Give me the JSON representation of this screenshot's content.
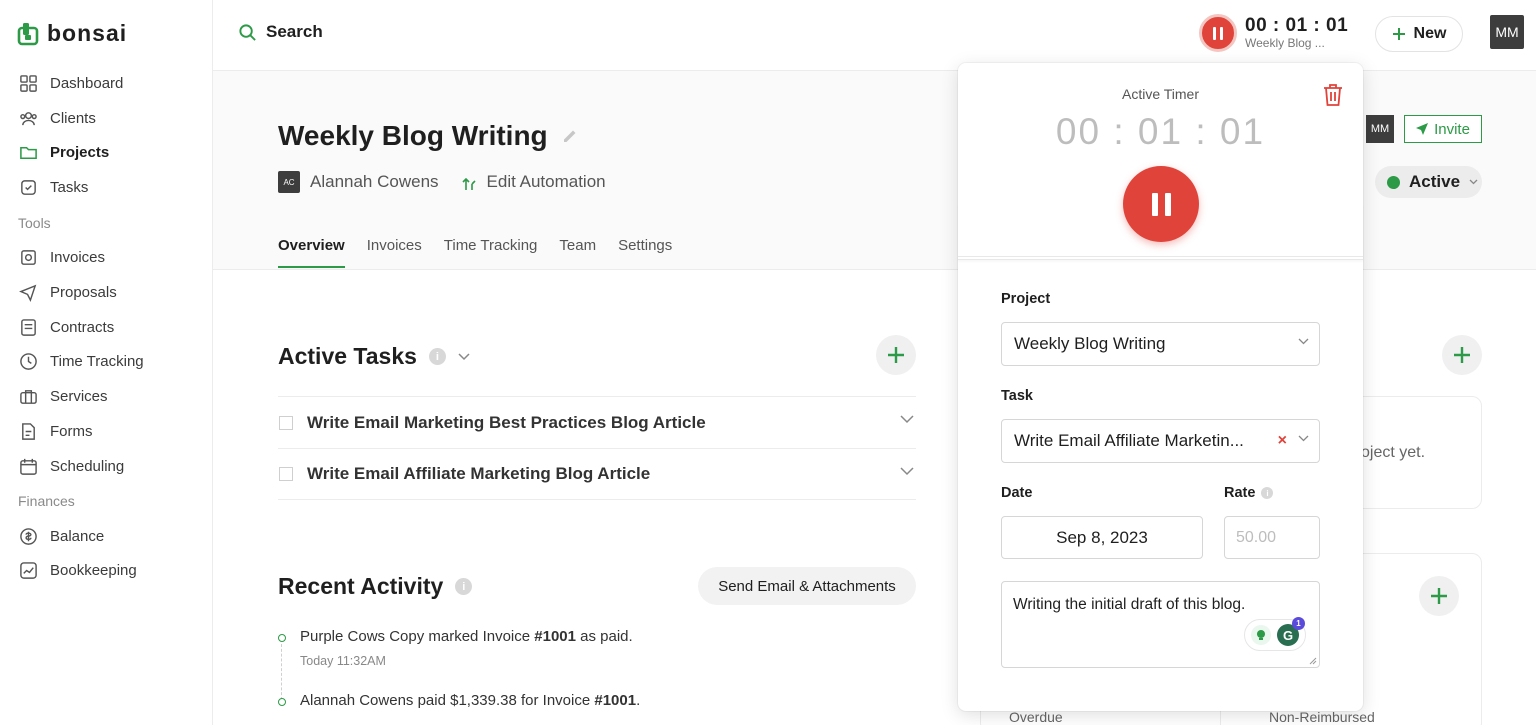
{
  "brand": {
    "name": "bonsai",
    "color": "#2c9a47"
  },
  "sidebar": {
    "items": [
      {
        "label": "Dashboard",
        "icon": "dashboard-icon"
      },
      {
        "label": "Clients",
        "icon": "clients-icon"
      },
      {
        "label": "Projects",
        "icon": "folder-icon",
        "active": true
      },
      {
        "label": "Tasks",
        "icon": "tasks-icon"
      }
    ],
    "tools_label": "Tools",
    "tools": [
      {
        "label": "Invoices",
        "icon": "invoice-icon"
      },
      {
        "label": "Proposals",
        "icon": "send-icon"
      },
      {
        "label": "Contracts",
        "icon": "contract-icon"
      },
      {
        "label": "Time Tracking",
        "icon": "clock-icon"
      },
      {
        "label": "Services",
        "icon": "briefcase-icon"
      },
      {
        "label": "Forms",
        "icon": "form-icon"
      },
      {
        "label": "Scheduling",
        "icon": "calendar-icon"
      }
    ],
    "finances_label": "Finances",
    "finances": [
      {
        "label": "Balance",
        "icon": "balance-icon"
      },
      {
        "label": "Bookkeeping",
        "icon": "chart-icon"
      }
    ]
  },
  "topbar": {
    "search_label": "Search",
    "timer": {
      "time": "00 : 01 : 01",
      "subtitle": "Weekly Blog ..."
    },
    "new_label": "New",
    "avatar": "MM"
  },
  "project": {
    "title": "Weekly Blog Writing",
    "client_initials": "AC",
    "client_name": "Alannah Cowens",
    "automation_label": "Edit Automation",
    "team_avatar": "MM",
    "invite_label": "Invite",
    "status": "Active",
    "tabs": [
      "Overview",
      "Invoices",
      "Time Tracking",
      "Team",
      "Settings"
    ]
  },
  "active_tasks": {
    "title": "Active Tasks",
    "items": [
      "Write Email Marketing Best Practices Blog Article",
      "Write Email Affiliate Marketing Blog Article"
    ]
  },
  "recent_activity": {
    "title": "Recent Activity",
    "send_button": "Send Email & Attachments",
    "items": [
      {
        "pre": "Purple Cows Copy marked Invoice ",
        "bold": "#1001",
        "post": " as paid.",
        "time": "Today 11:32AM"
      },
      {
        "pre": "Alannah Cowens paid $1,339.38 for Invoice ",
        "bold": "#1001",
        "post": ".",
        "time": ""
      }
    ]
  },
  "right_panel": {
    "empty_text": "oject yet.",
    "label_overdue": "Overdue",
    "label_nonreimbursed": "Non-Reimbursed"
  },
  "timer_popup": {
    "label": "Active Timer",
    "time": "00 : 01 : 01",
    "project_label": "Project",
    "project_value": "Weekly Blog Writing",
    "task_label": "Task",
    "task_value": "Write Email Affiliate Marketin...",
    "date_label": "Date",
    "date_value": "Sep 8, 2023",
    "rate_label": "Rate",
    "rate_placeholder": "50.00",
    "notes_value": "Writing the initial draft of this blog.",
    "grammarly_count": "1"
  }
}
